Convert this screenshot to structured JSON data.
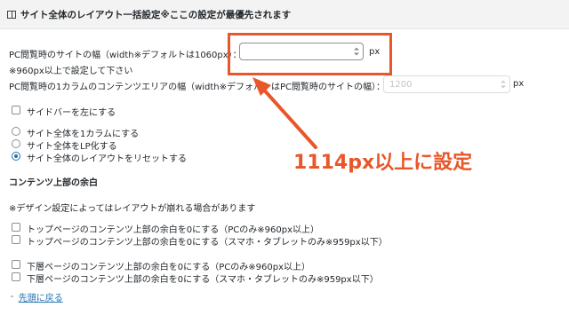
{
  "header": {
    "title": "サイト全体のレイアウト一括設定※ここの設定が最優先されます",
    "icon": "book-icon"
  },
  "width_setting": {
    "label": "PC閲覧時のサイトの幅（width※デフォルトは1060px）：",
    "value": "",
    "unit": "px",
    "note": "※960px以上で設定して下さい"
  },
  "column_setting": {
    "label": "PC閲覧時の1カラムのコンテンツエリアの幅（width※デフォルトはPC閲覧時のサイトの幅）：",
    "placeholder": "1200",
    "unit": "px"
  },
  "sidebar_left": {
    "label": "サイドバーを左にする",
    "checked": false
  },
  "layout_options": [
    {
      "label": "サイト全体を1カラムにする",
      "checked": false
    },
    {
      "label": "サイト全体をLP化する",
      "checked": false
    },
    {
      "label": "サイト全体のレイアウトをリセットする",
      "checked": true
    }
  ],
  "top_margin": {
    "heading": "コンテンツ上部の余白",
    "note": "※デザイン設定によってはレイアウトが崩れる場合があります",
    "options": [
      {
        "label": "トップページのコンテンツ上部の余白を0にする（PCのみ※960px以上）"
      },
      {
        "label": "トップページのコンテンツ上部の余白を0にする（スマホ・タブレットのみ※959px以下）"
      },
      {
        "label": "下層ページのコンテンツ上部の余白を0にする（PCのみ※960px以上）"
      },
      {
        "label": "下層ページのコンテンツ上部の余白を0にする（スマホ・タブレットのみ※959px以下）"
      }
    ]
  },
  "back_link": {
    "label": "先頭に戻る"
  },
  "annotation": {
    "text": "1114px以上に設定",
    "color": "#e8572a"
  }
}
